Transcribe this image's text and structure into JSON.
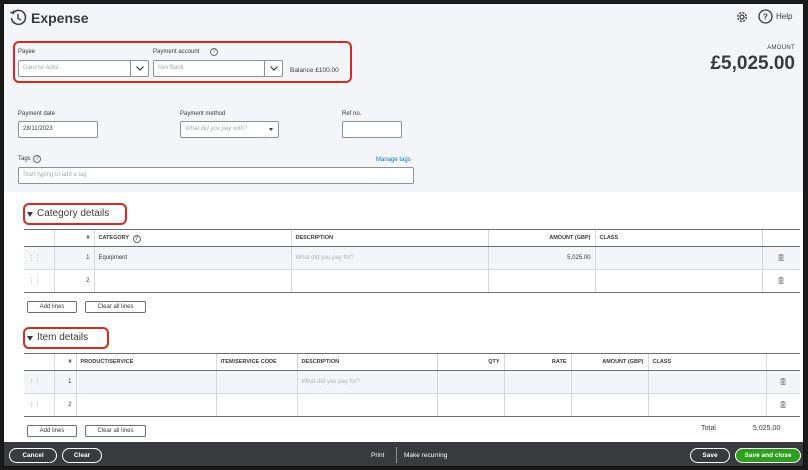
{
  "header": {
    "title": "Expense",
    "help_label": "Help"
  },
  "amount": {
    "caption": "AMOUNT",
    "value": "£5,025.00"
  },
  "payee": {
    "label": "Payee",
    "value": "Gauche Adisi"
  },
  "payment_account": {
    "label": "Payment account",
    "value": "Kev Bank",
    "balance": "Balance £100.00"
  },
  "payment_date": {
    "label": "Payment date",
    "value": "28/11/2023"
  },
  "payment_method": {
    "label": "Payment method",
    "placeholder": "What did you pay with?"
  },
  "ref_no": {
    "label": "Ref no.",
    "value": ""
  },
  "tags": {
    "label": "Tags",
    "manage_link": "Manage tags",
    "placeholder": "Start typing to add a tag"
  },
  "category_details": {
    "title": "Category details",
    "columns": {
      "num": "#",
      "category": "CATEGORY",
      "description": "DESCRIPTION",
      "amount": "AMOUNT (GBP)",
      "class": "CLASS"
    },
    "rows": [
      {
        "num": "1",
        "category": "Equipment",
        "description": "What did you pay for?",
        "amount": "5,025.00",
        "class": ""
      },
      {
        "num": "2",
        "category": "",
        "description": "",
        "amount": "",
        "class": ""
      }
    ],
    "add_lines": "Add lines",
    "clear_all_lines": "Clear all lines"
  },
  "item_details": {
    "title": "Item details",
    "columns": {
      "num": "#",
      "product": "PRODUCT/SERVICE",
      "code": "ITEM/SERVICE CODE",
      "description": "DESCRIPTION",
      "qty": "QTY",
      "rate": "RATE",
      "amount": "AMOUNT (GBP)",
      "class": "CLASS"
    },
    "rows": [
      {
        "num": "1",
        "description": "What did you pay for?"
      },
      {
        "num": "2",
        "description": ""
      }
    ],
    "add_lines": "Add lines",
    "clear_all_lines": "Clear all lines"
  },
  "total": {
    "label": "Total",
    "value": "5,025.00"
  },
  "footer": {
    "cancel": "Cancel",
    "clear": "Clear",
    "print": "Print",
    "make_recurring": "Make recurring",
    "save": "Save",
    "save_and_close": "Save and close"
  },
  "colors": {
    "highlight": "#d52b1e",
    "link": "#0077c5",
    "primary_button": "#2ca01c",
    "footer_bg": "#393a3d"
  }
}
